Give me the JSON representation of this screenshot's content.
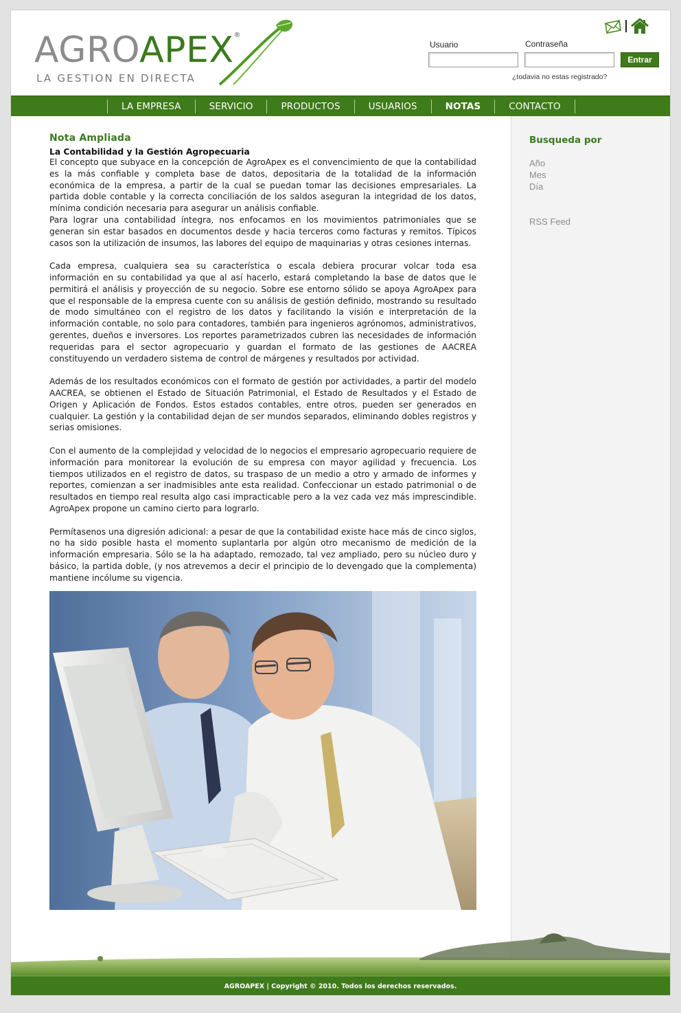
{
  "header": {
    "logo": {
      "agro": "AGRO",
      "apex": "APEX",
      "registered": "®",
      "tagline": "LA GESTION EN DIRECTA"
    },
    "icons": {
      "mail": "mail-icon",
      "home": "home-icon"
    },
    "login": {
      "user_label": "Usuario",
      "user_value": "",
      "password_label": "Contraseña",
      "password_value": "",
      "submit_label": "Entrar",
      "register_link": "¿todavia no estas registrado?"
    }
  },
  "nav": {
    "items": [
      {
        "label": "LA EMPRESA"
      },
      {
        "label": "SERVICIO"
      },
      {
        "label": "PRODUCTOS"
      },
      {
        "label": "USUARIOS"
      },
      {
        "label": "NOTAS",
        "active": true
      },
      {
        "label": "CONTACTO"
      }
    ]
  },
  "main": {
    "heading": "Nota Ampliada",
    "title": "La Contabilidad y la Gestión Agropecuaria",
    "paragraphs": [
      "El concepto que subyace en la concepción de AgroApex es el convencimiento de que la contabilidad es la más confiable y completa base de datos, depositaria de la totalidad de la información económica de la empresa, a partir de la cual se puedan tomar las decisiones empresariales. La partida doble contable y la correcta conciliación de los saldos aseguran la integridad de los datos, mínima condición necesaria para asegurar un análisis confiable.",
      "Para lograr una contabilidad íntegra, nos enfocamos en los movimientos patrimoniales que se generan sin estar basados en documentos desde y hacia terceros como facturas y remitos. Típicos casos son la utilización de insumos, las labores del equipo de maquinarias y otras cesiones internas.",
      "Cada empresa, cualquiera sea su característica o escala debiera procurar volcar toda esa información en su contabilidad ya que al así hacerlo, estará completando la base de datos que le permitirá el análisis y proyección de su negocio. Sobre ese entorno sólido se apoya AgroApex para que el responsable de la empresa cuente con su análisis de gestión definido, mostrando su resultado de modo simultáneo con el registro de los datos y facilitando la visión e interpretación de la información contable, no solo para contadores, también para ingenieros agrónomos, administrativos, gerentes, dueños e inversores. Los reportes parametrizados cubren las necesidades de información requeridas para el sector agropecuario y guardan el formato de las gestiones de AACREA constituyendo un verdadero sistema de control de márgenes y resultados por actividad.",
      "Además de los resultados económicos con el formato de gestión por actividades, a partir del modelo AACREA,  se obtienen el Estado de Situación Patrimonial, el Estado de Resultados y el Estado de Origen y Aplicación de Fondos. Estos estados contables, entre otros, pueden ser generados en cualquier. La gestión y la contabilidad dejan de ser mundos separados, eliminando dobles registros y serias omisiones.",
      "Con el aumento de la complejidad y velocidad de lo negocios el empresario agropecuario requiere de información para monitorear la evolución de su empresa con mayor agilidad y frecuencia. Los tiempos utilizados en el registro de datos, su traspaso de un medio a otro y armado de informes y reportes, comienzan a ser inadmisibles ante esta realidad. Confeccionar un estado patrimonial o de resultados en tiempo real resulta algo casi impracticable pero a la vez cada vez más imprescindible. AgroApex propone un camino cierto para lograrlo.",
      "Permítasenos una digresión adicional: a pesar de que la contabilidad existe hace más de cinco siglos, no ha sido posible hasta el momento suplantarla por algún otro mecanismo de medición de la información empresaria. Sólo se la ha adaptado, remozado, tal vez ampliado, pero su núcleo duro y básico, la partida doble, (y nos atrevemos a decir el principio de lo devengado que la complementa) mantiene incólume su vigencia."
    ]
  },
  "sidebar": {
    "heading": "Busqueda por",
    "links": {
      "anio": "Año",
      "mes": "Mes",
      "dia": "Día",
      "rss": "RSS Feed"
    }
  },
  "footer": {
    "text": "AGROAPEX | Copyright © 2010. Todos los derechos reservados."
  },
  "colors": {
    "brand_green": "#3f7a1b",
    "logo_grey": "#8c8c8c",
    "sidebar_bg": "#f3f3f3"
  }
}
